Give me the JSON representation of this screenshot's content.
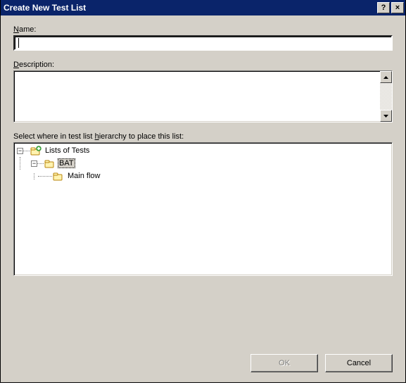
{
  "window": {
    "title": "Create New Test List",
    "help_glyph": "?",
    "close_glyph": "×"
  },
  "labels": {
    "name": "Name:",
    "description": "Description:",
    "hierarchy": "Select where in test list hierarchy to place this list:"
  },
  "fields": {
    "name_value": "",
    "description_value": ""
  },
  "tree": {
    "n0": {
      "label": "Lists of Tests",
      "expanded": true
    },
    "n1": {
      "label": "BAT",
      "expanded": true,
      "selected": true
    },
    "n2": {
      "label": "Main flow"
    }
  },
  "buttons": {
    "ok": "OK",
    "cancel": "Cancel",
    "ok_enabled": false
  }
}
